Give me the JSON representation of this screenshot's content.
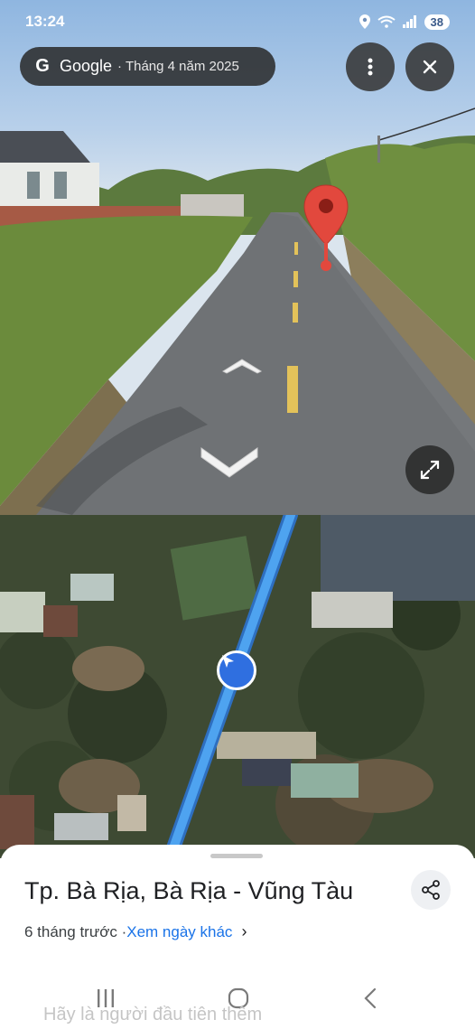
{
  "status_bar": {
    "time": "13:24",
    "battery": "38"
  },
  "header": {
    "brand": "Google",
    "date": "· Tháng 4 năm 2025"
  },
  "icons": {
    "google": "G",
    "menu": "more-vert-icon",
    "close": "close-icon",
    "expand": "expand-icon",
    "share": "share-icon",
    "pin": "location-pin-icon",
    "nav": "navigation-arrow-icon",
    "chevron": "›"
  },
  "sheet": {
    "place_name": "Tp. Bà Rịa, Bà Rịa - Vũng Tàu",
    "time_ago": "6 tháng trước · ",
    "other_dates_link": "Xem ngày khác",
    "faded_text": "Hãy là người đầu tiên thêm"
  },
  "colors": {
    "pin": "#e2483d",
    "route": "#4ea3f0",
    "nav_dot": "#2f6fe0",
    "link": "#1a73e8"
  }
}
